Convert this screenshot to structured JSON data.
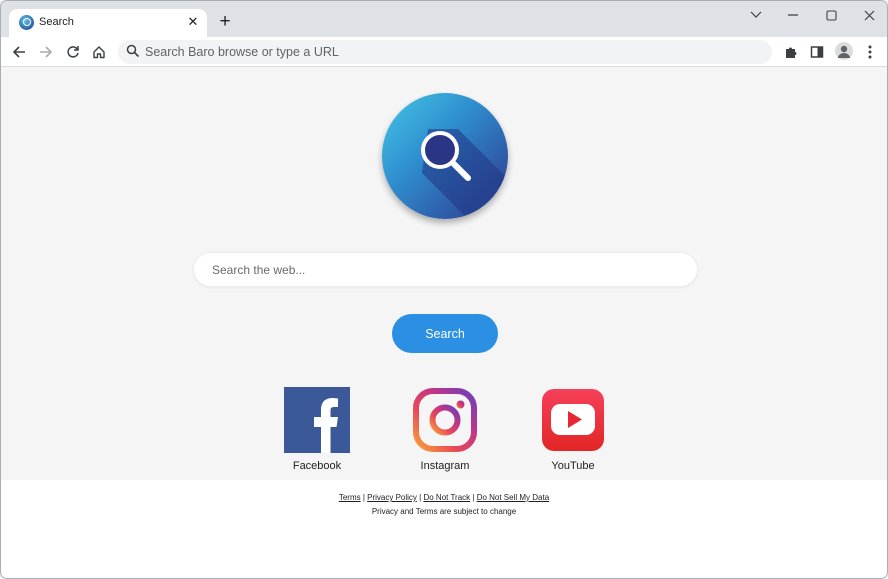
{
  "browser": {
    "tab": {
      "title": "Search"
    },
    "omnibox": {
      "placeholder": "Search Baro browse or type a URL"
    }
  },
  "page": {
    "search": {
      "placeholder": "Search the web...",
      "button_label": "Search"
    },
    "shortcuts": [
      {
        "label": "Facebook",
        "icon": "facebook-icon",
        "color": "#3b5998"
      },
      {
        "label": "Instagram",
        "icon": "instagram-icon",
        "color": "#c13584"
      },
      {
        "label": "YouTube",
        "icon": "youtube-icon",
        "color": "#e62630"
      }
    ],
    "footer": {
      "links": [
        "Terms",
        "Privacy Policy",
        "Do Not Track",
        "Do Not Sell My Data"
      ],
      "note": "Privacy and Terms are subject to change"
    }
  },
  "colors": {
    "accent": "#2b8fe3",
    "tab_strip": "#dee1e6",
    "page_bg": "#f5f5f5"
  }
}
